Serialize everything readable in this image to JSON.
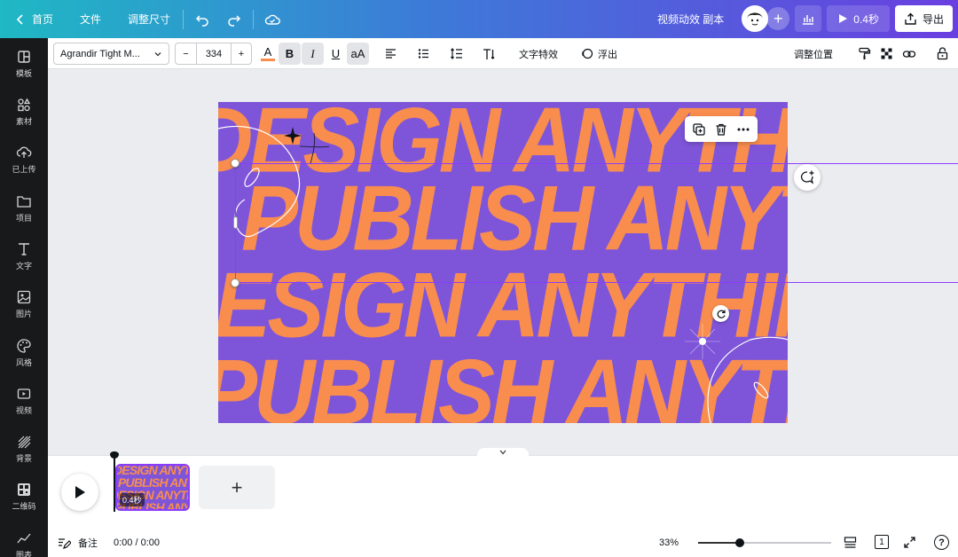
{
  "topbar": {
    "home_label": "首页",
    "file_label": "文件",
    "resize_label": "调整尺寸",
    "doc_title": "视频动效 副本",
    "present_label": "0.4秒",
    "export_label": "导出",
    "gradient_start": "#1fb8c4",
    "gradient_end": "#6a3fe0"
  },
  "sidebar": {
    "items": [
      {
        "label": "模板",
        "icon": "template-icon"
      },
      {
        "label": "素材",
        "icon": "elements-icon"
      },
      {
        "label": "已上传",
        "icon": "upload-icon"
      },
      {
        "label": "项目",
        "icon": "folder-icon"
      },
      {
        "label": "文字",
        "icon": "text-icon"
      },
      {
        "label": "图片",
        "icon": "image-icon"
      },
      {
        "label": "风格",
        "icon": "palette-icon"
      },
      {
        "label": "视频",
        "icon": "video-icon"
      },
      {
        "label": "背景",
        "icon": "background-icon"
      },
      {
        "label": "二维码",
        "icon": "qrcode-icon"
      },
      {
        "label": "图表",
        "icon": "chart-icon"
      }
    ]
  },
  "toolbar": {
    "font_name": "Agrandir Tight M...",
    "font_size": "334",
    "minus": "−",
    "plus": "+",
    "bold": "B",
    "italic": "I",
    "underline": "U",
    "case": "aA",
    "text_effects": "文字特效",
    "animate": "浮出",
    "position": "调整位置",
    "text_color": "#f98d4e"
  },
  "canvas": {
    "lines": [
      "DESIGN ANYTHING",
      "PUBLISH ANYTHING",
      "DESIGN ANYTHING",
      "PUBLISH ANYTHING"
    ],
    "background": "#7e55d9",
    "text_color": "#f98d4e"
  },
  "timeline": {
    "clip_lines": [
      "DESIGN ANYTHING",
      "PUBLISH ANYTHING",
      "DESIGN ANYTHING",
      "PUBLISH ANYTHING"
    ],
    "clip_duration": "0.4秒",
    "add_label": "+",
    "notes_label": "备注",
    "time_display": "0:00 / 0:00",
    "zoom": "33%",
    "zoom_level": 0.31,
    "page_number": "1"
  }
}
